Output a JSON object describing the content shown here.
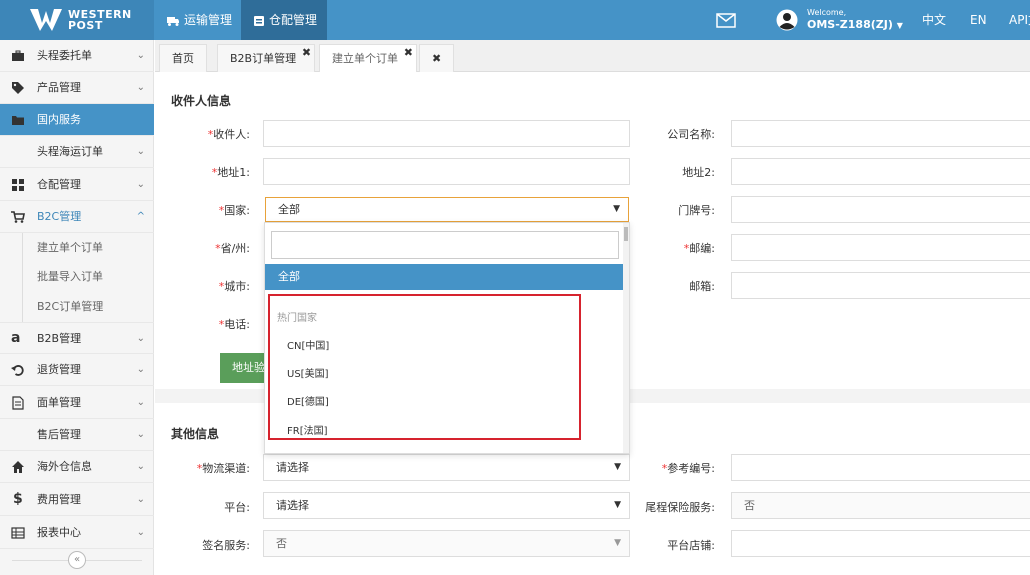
{
  "brand": {
    "line1": "WESTERN",
    "line2": "POST",
    "color": "#4593c7"
  },
  "top_nav": [
    {
      "label": "运输管理",
      "icon": "truck-icon"
    },
    {
      "label": "仓配管理",
      "icon": "warehouse-icon",
      "active": true
    }
  ],
  "header_right": {
    "mail_icon": "mail-icon",
    "welcome": "Welcome,",
    "user": "OMS-Z188(ZJ)",
    "lang_zh": "中文",
    "lang_en": "EN",
    "api": "API文"
  },
  "sidebar": {
    "items": [
      {
        "label": "头程委托单",
        "icon": "briefcase-icon"
      },
      {
        "label": "产品管理",
        "icon": "tag-icon"
      },
      {
        "label": "国内服务",
        "icon": "folder-icon",
        "active": true
      },
      {
        "label": "头程海运订单"
      },
      {
        "label": "仓配管理",
        "icon": "grid-icon"
      },
      {
        "label": "B2C管理",
        "icon": "cart-icon",
        "open": true
      },
      {
        "label": "B2B管理",
        "icon": "amazon-icon"
      },
      {
        "label": "退货管理",
        "icon": "undo-icon"
      },
      {
        "label": "面单管理",
        "icon": "document-icon"
      },
      {
        "label": "售后管理"
      },
      {
        "label": "海外仓信息",
        "icon": "home-icon"
      },
      {
        "label": "费用管理",
        "icon": "dollar-icon"
      },
      {
        "label": "报表中心",
        "icon": "table-icon"
      }
    ],
    "sub_items": [
      "建立单个订单",
      "批量导入订单",
      "B2C订单管理"
    ],
    "collapse_glyph": "«"
  },
  "tabs": [
    {
      "label": "首页"
    },
    {
      "label": "B2B订单管理",
      "close": "✖"
    },
    {
      "label": "建立单个订单",
      "close": "✖",
      "active": true
    },
    {
      "label": "✖"
    }
  ],
  "recipient": {
    "title": "收件人信息",
    "required_mark": "*",
    "recipient_label": "收件人:",
    "company_label": "公司名称:",
    "address1_label": "地址1:",
    "address2_label": "地址2:",
    "country_label": "国家:",
    "country_value": "全部",
    "house_no_label": "门牌号:",
    "province_label": "省/州:",
    "zip_label": "邮编:",
    "city_label": "城市:",
    "email_label": "邮箱:",
    "phone_label": "电话:",
    "verify_button": "地址验证"
  },
  "country_dropdown": {
    "search_value": "",
    "selected": "全部",
    "group": "热门国家",
    "options": [
      "CN[中国]",
      "US[美国]",
      "DE[德国]",
      "FR[法国]"
    ]
  },
  "other_info": {
    "title": "其他信息",
    "channel_label": "物流渠道:",
    "channel_value": "请选择",
    "ref_label": "参考编号:",
    "platform_label": "平台:",
    "platform_value": "请选择",
    "insurance_label": "尾程保险服务:",
    "insurance_value": "否",
    "sign_label": "签名服务:",
    "sign_value": "否",
    "shop_label": "平台店铺:"
  }
}
